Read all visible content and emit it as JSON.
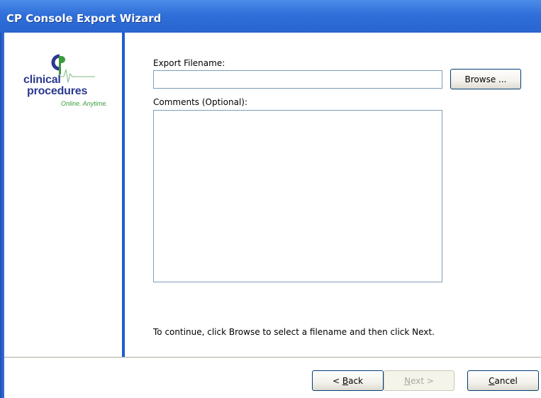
{
  "window": {
    "title": "CP Console Export Wizard"
  },
  "logo": {
    "word1": "clinical",
    "word2": "procedures",
    "tagline": "Online. Anytime."
  },
  "form": {
    "filename_label": "Export Filename:",
    "filename_value": "",
    "browse_label": "Browse ...",
    "comments_label": "Comments (Optional):",
    "comments_value": "",
    "hint": "To continue, click Browse to select a filename and then click Next."
  },
  "footer": {
    "back_prefix": "< ",
    "back_mnemonic": "B",
    "back_rest": "ack",
    "next_mnemonic": "N",
    "next_rest": "ext >",
    "cancel_mnemonic": "C",
    "cancel_rest": "ancel"
  },
  "colors": {
    "title_bar": "#2f6fd9",
    "sidebar_rule": "#1f5cd1",
    "logo_text": "#2b3990",
    "logo_accent": "#3a9b3a"
  }
}
